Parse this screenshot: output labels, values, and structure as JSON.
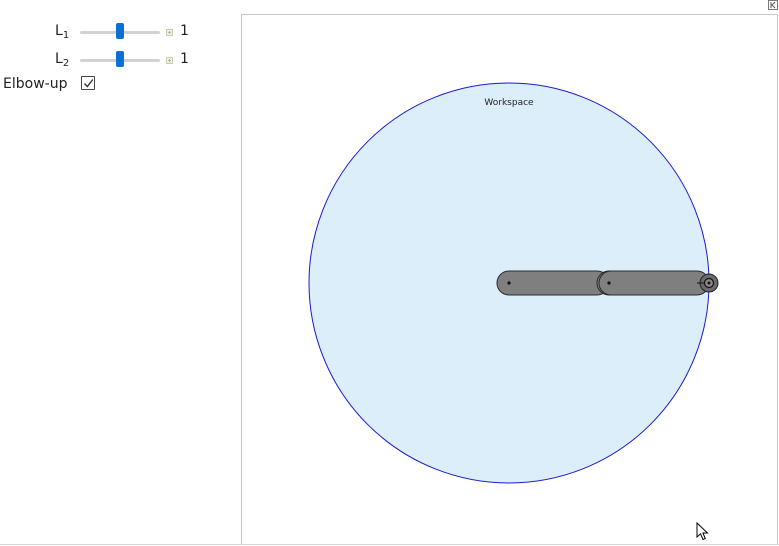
{
  "controls": {
    "l1": {
      "label": "L",
      "sub": "1",
      "value": "1",
      "fraction": 0.5
    },
    "l2": {
      "label": "L",
      "sub": "2",
      "value": "1",
      "fraction": 0.5
    },
    "elbow": {
      "label": "Elbow-up",
      "checked": true
    }
  },
  "plot": {
    "workspace_label": "Workspace",
    "workspace_radius": 2,
    "l1": 1,
    "l2": 1,
    "joint1_angle_deg": 0,
    "joint2_angle_deg": 0,
    "colors": {
      "workspace_fill": "#ddeefb",
      "workspace_stroke": "#1a1acc",
      "link_fill": "#7f7f7f",
      "link_stroke": "#2b2b2b"
    }
  },
  "icons": {
    "checkmark": "check-icon",
    "corner": "collapse-icon",
    "cursor": "mouse-pointer-icon"
  }
}
